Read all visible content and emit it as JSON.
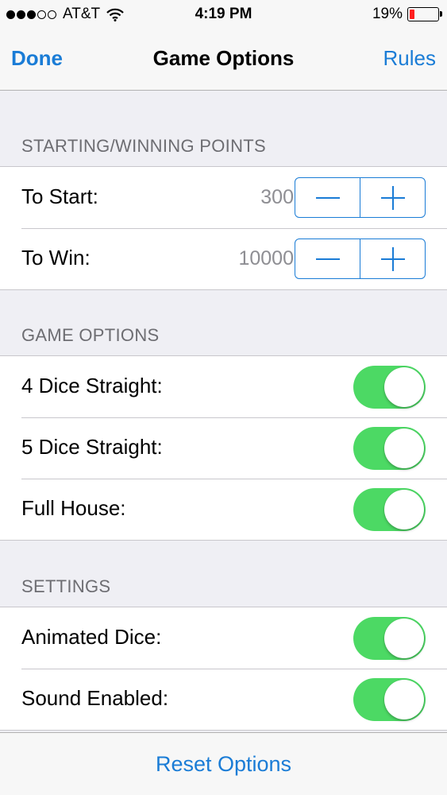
{
  "status_bar": {
    "signal_dots_filled": 3,
    "signal_dots_total": 5,
    "carrier": "AT&T",
    "time": "4:19 PM",
    "battery_percent": "19%",
    "battery_level": 0.19,
    "icons": [
      "wifi-icon",
      "battery-icon"
    ]
  },
  "nav": {
    "done_label": "Done",
    "title": "Game Options",
    "rules_label": "Rules"
  },
  "sections": {
    "points": {
      "header": "STARTING/WINNING POINTS",
      "to_start": {
        "label": "To Start:",
        "value": "300"
      },
      "to_win": {
        "label": "To Win:",
        "value": "10000"
      }
    },
    "game_options": {
      "header": "GAME OPTIONS",
      "four_dice": {
        "label": "4 Dice Straight:",
        "on": true
      },
      "five_dice": {
        "label": "5 Dice Straight:",
        "on": true
      },
      "full_house": {
        "label": "Full House:",
        "on": true
      }
    },
    "settings": {
      "header": "SETTINGS",
      "animated_dice": {
        "label": "Animated Dice:",
        "on": true
      },
      "sound_enabled": {
        "label": "Sound Enabled:",
        "on": true
      }
    }
  },
  "footer": {
    "reset_label": "Reset Options"
  },
  "colors": {
    "accent": "#1a7cd6",
    "toggle_on": "#4cd964",
    "battery_low": "#ff1f1f"
  }
}
